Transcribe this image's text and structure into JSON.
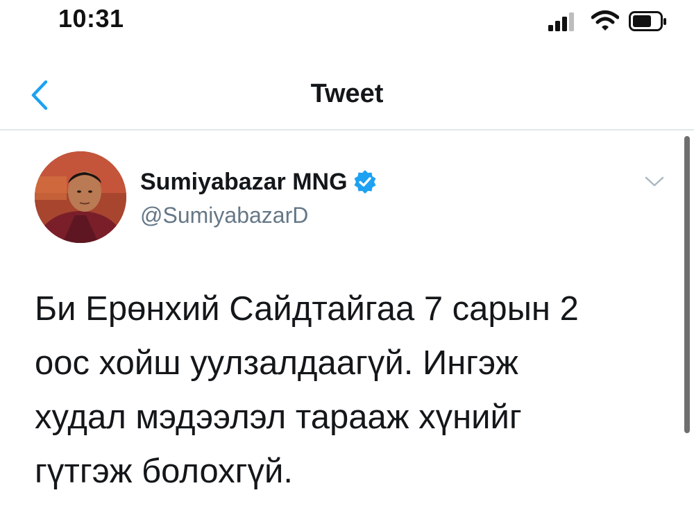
{
  "status_bar": {
    "time": "10:31"
  },
  "nav": {
    "title": "Tweet"
  },
  "tweet": {
    "author_name": "Sumiyabazar MNG",
    "author_handle": "@SumiyabazarD",
    "verified": true,
    "text": "Би Ерөнхий Сайдтайгаа 7 сарын 2\nоос хойш уулзалдаагүй. Ингэж\nхудал мэдээлэл тарааж хүнийг\nгүтгэж болохгүй."
  },
  "colors": {
    "accent": "#1da1f2",
    "handle": "#657786",
    "text": "#14171a",
    "divider": "#e1e8ed"
  },
  "icons": {
    "back": "chevron-left-icon",
    "verified": "verified-badge-icon",
    "more": "chevron-down-icon",
    "signal": "signal-icon",
    "wifi": "wifi-icon",
    "battery": "battery-icon"
  }
}
